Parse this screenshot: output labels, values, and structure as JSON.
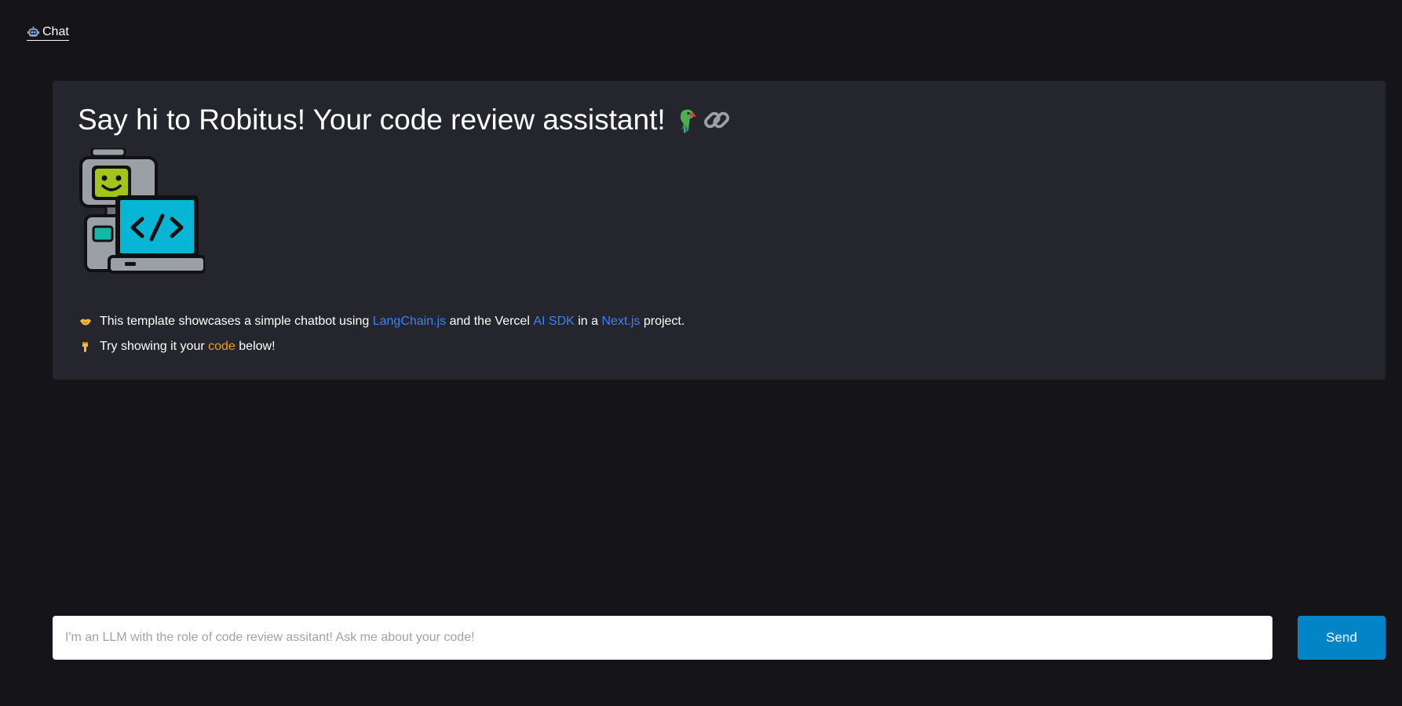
{
  "nav": {
    "chat_label": "Chat",
    "chat_icon": "robot-icon"
  },
  "card": {
    "title": "Say hi to Robitus! Your code review assistant!",
    "title_icons": [
      "parrot-icon",
      "link-icon"
    ],
    "hero_image": "robot-laptop-code-illustration",
    "line1": {
      "icon": "handshake-icon",
      "text_a": "This template showcases a simple chatbot using ",
      "link_langchain": "LangChain.js",
      "text_b": " and the Vercel ",
      "link_aisdk": "AI SDK",
      "text_c": " in a ",
      "link_nextjs": "Next.js",
      "text_d": " project."
    },
    "line2": {
      "icon": "pointing-down-icon",
      "text_a": "Try showing it your ",
      "highlight": "code",
      "text_b": " below!"
    }
  },
  "composer": {
    "placeholder": "I'm an LLM with the role of code review assitant! Ask me about your code!",
    "value": "",
    "send_label": "Send"
  },
  "colors": {
    "background": "#141419",
    "card": "#25252d",
    "link": "#3b82f6",
    "highlight": "#f59e0b",
    "send_button": "#0284c7"
  }
}
